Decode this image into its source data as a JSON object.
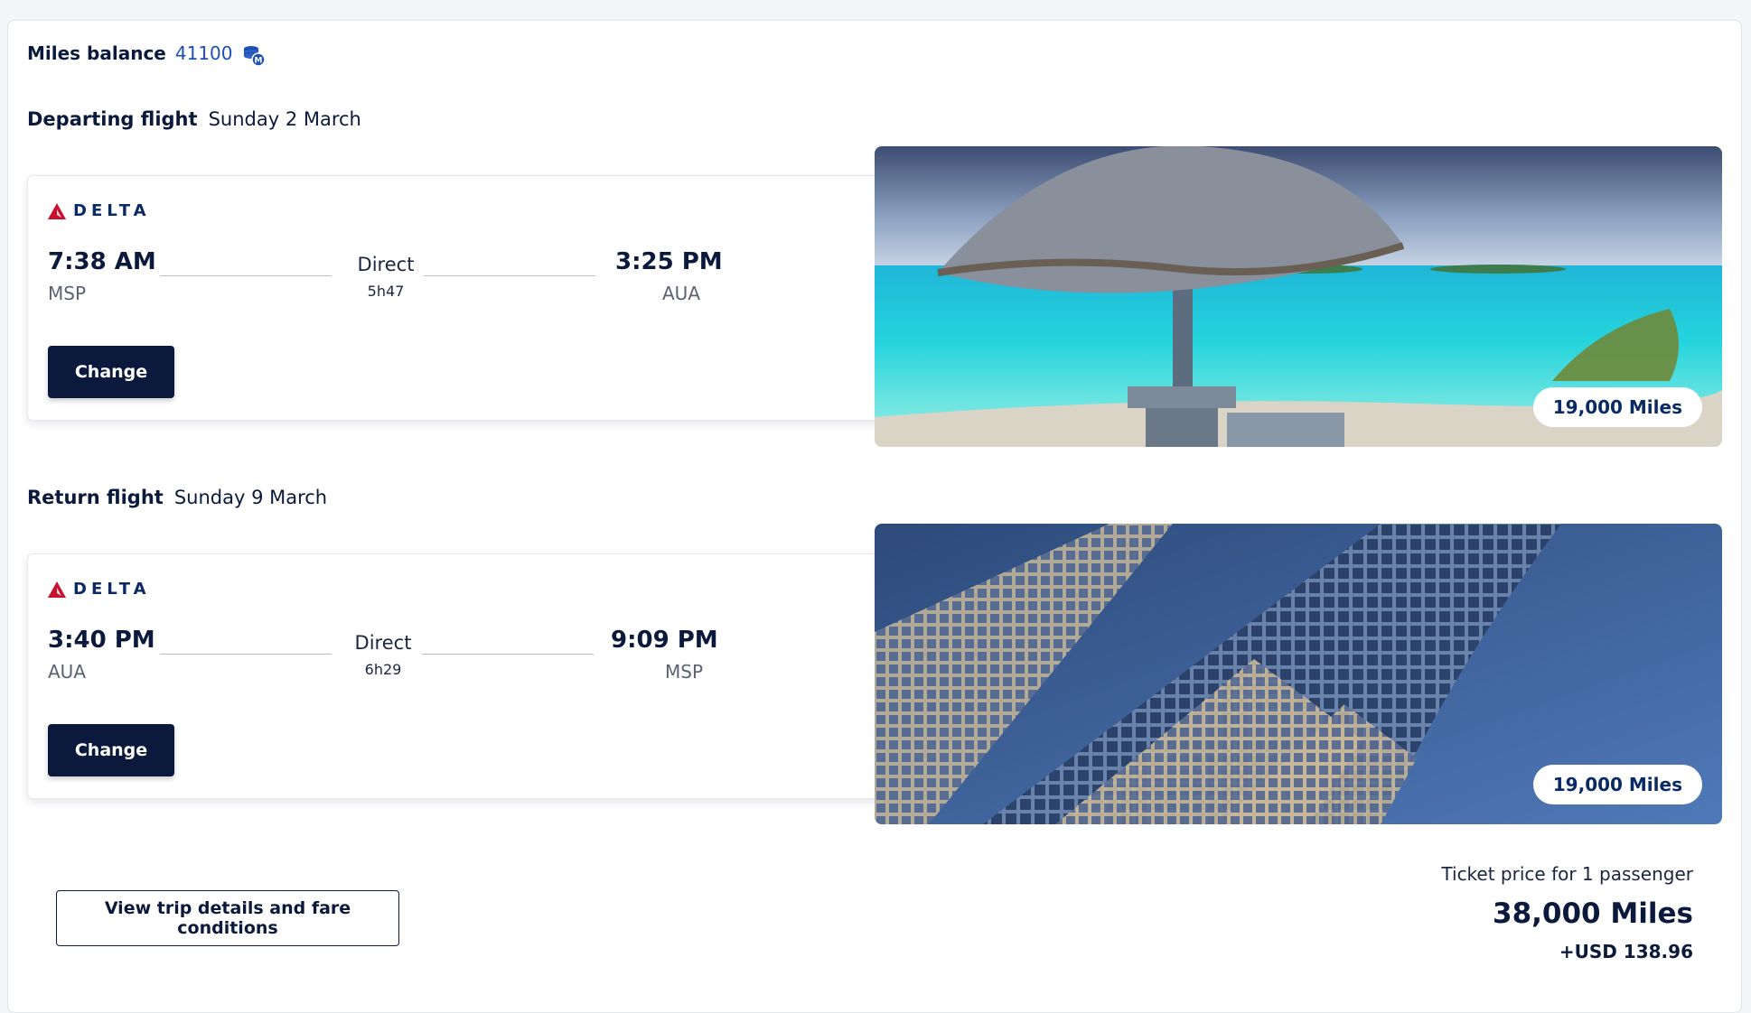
{
  "miles_balance": {
    "label": "Miles balance",
    "value": "41100"
  },
  "outbound": {
    "section_label": "Departing flight",
    "date": "Sunday 2 March",
    "airline": "DELTA",
    "depart_time": "7:38 AM",
    "depart_code": "MSP",
    "stops": "Direct",
    "duration": "5h47",
    "arrive_time": "3:25 PM",
    "arrive_code": "AUA",
    "change_label": "Change",
    "miles_badge": "19,000 Miles"
  },
  "return": {
    "section_label": "Return flight",
    "date": "Sunday 9 March",
    "airline": "DELTA",
    "depart_time": "3:40 PM",
    "depart_code": "AUA",
    "stops": "Direct",
    "duration": "6h29",
    "arrive_time": "9:09 PM",
    "arrive_code": "MSP",
    "change_label": "Change",
    "miles_badge": "19,000 Miles"
  },
  "footer": {
    "details_button": "View trip details and fare conditions",
    "price_caption": "Ticket price for 1 passenger",
    "total_miles": "38,000 Miles",
    "total_usd": "+USD 138.96"
  },
  "colors": {
    "navy": "#0b1a3c",
    "accent_blue": "#1f4fb4",
    "delta_red": "#c8102e"
  },
  "icons": {
    "miles": "miles-coin-icon",
    "airline": "delta-logo-icon"
  }
}
